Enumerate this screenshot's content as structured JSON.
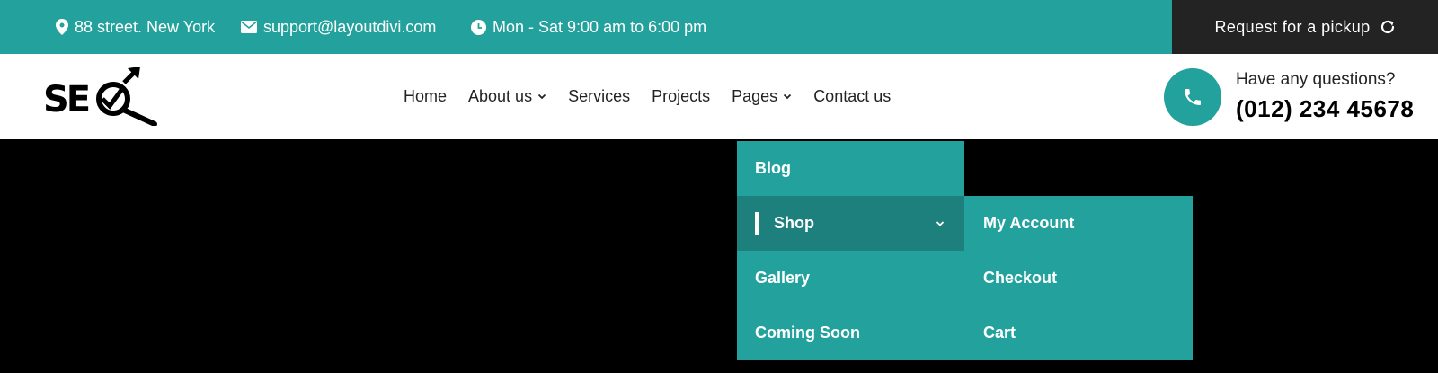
{
  "topbar": {
    "address": "88 street. New York",
    "email": "support@layoutdivi.com",
    "hours": "Mon - Sat 9:00 am to 6:00 pm",
    "pickup_label": "Request for a pickup"
  },
  "header": {
    "logo_text": "SEO",
    "nav": [
      {
        "label": "Home",
        "dropdown": false
      },
      {
        "label": "About us",
        "dropdown": true
      },
      {
        "label": "Services",
        "dropdown": false
      },
      {
        "label": "Projects",
        "dropdown": false
      },
      {
        "label": "Pages",
        "dropdown": true
      },
      {
        "label": "Contact us",
        "dropdown": false
      }
    ],
    "contact_question": "Have any questions?",
    "contact_phone": "(012) 234 45678"
  },
  "pages_menu": {
    "items": [
      {
        "label": "Blog"
      },
      {
        "label": "Shop",
        "active": true
      },
      {
        "label": "Gallery"
      },
      {
        "label": "Coming Soon"
      }
    ],
    "shop_submenu": [
      "My Account",
      "Checkout",
      "Cart"
    ]
  },
  "colors": {
    "accent": "#23a19c",
    "accent_dark": "#1e807d",
    "dark": "#232323"
  },
  "icons": {
    "address": "map-pin-icon",
    "email": "envelope-icon",
    "hours": "clock-icon",
    "pickup": "refresh-icon",
    "phone": "phone-icon"
  }
}
